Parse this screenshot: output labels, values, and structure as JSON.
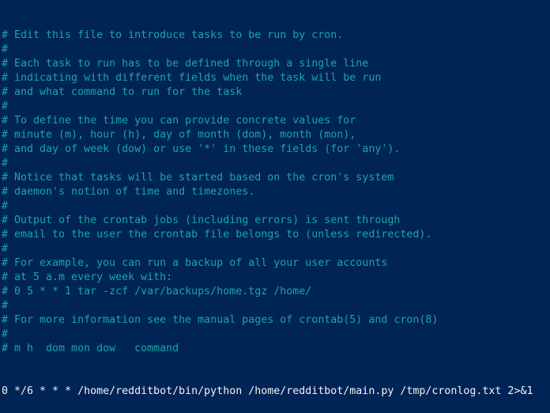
{
  "terminal": {
    "colors": {
      "background": "#012456",
      "comment": "#1ba5a5",
      "command": "#f2f2f2"
    },
    "comment_lines": [
      "# Edit this file to introduce tasks to be run by cron.",
      "#",
      "# Each task to run has to be defined through a single line",
      "# indicating with different fields when the task will be run",
      "# and what command to run for the task",
      "#",
      "# To define the time you can provide concrete values for",
      "# minute (m), hour (h), day of month (dom), month (mon),",
      "# and day of week (dow) or use '*' in these fields (for 'any').",
      "#",
      "# Notice that tasks will be started based on the cron's system",
      "# daemon's notion of time and timezones.",
      "#",
      "# Output of the crontab jobs (including errors) is sent through",
      "# email to the user the crontab file belongs to (unless redirected).",
      "#",
      "# For example, you can run a backup of all your user accounts",
      "# at 5 a.m every week with:",
      "# 0 5 * * 1 tar -zcf /var/backups/home.tgz /home/",
      "#",
      "# For more information see the manual pages of crontab(5) and cron(8)",
      "#",
      "# m h  dom mon dow   command"
    ],
    "cron_entry": "0 */6 * * * /home/redditbot/bin/python /home/redditbot/main.py /tmp/cronlog.txt 2>&1"
  }
}
